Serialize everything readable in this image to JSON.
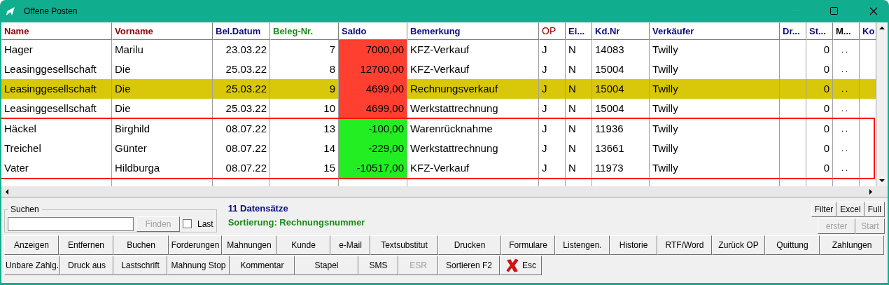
{
  "window": {
    "title": "Offene Posten"
  },
  "table": {
    "columns": [
      {
        "label": "Name",
        "color": "#8b0000"
      },
      {
        "label": "Vorname",
        "color": "#8b0000"
      },
      {
        "label": "Bel.Datum",
        "color": "#0a0a80"
      },
      {
        "label": "Beleg-Nr.",
        "color": "#1a8a1a"
      },
      {
        "label": "Saldo",
        "color": "#0a0a80"
      },
      {
        "label": "Bemerkung",
        "color": "#0a0a80"
      },
      {
        "label": "OP",
        "color": "#a00000"
      },
      {
        "label": "Ei...",
        "color": "#0a0a80"
      },
      {
        "label": "Kd.Nr",
        "color": "#0a0a80"
      },
      {
        "label": "Verkäufer",
        "color": "#0a0a80"
      },
      {
        "label": "Dr...",
        "color": "#0a0a80"
      },
      {
        "label": "St...",
        "color": "#0a0a80"
      },
      {
        "label": "M...",
        "color": "#000000"
      },
      {
        "label": "Ko",
        "color": "#0a0a80"
      }
    ],
    "rows": [
      {
        "name": "Hager",
        "vorname": "Marilu",
        "datum": "23.03.22",
        "beleg": "7",
        "saldo": {
          "text": "7000,00",
          "color": "#ff4030"
        },
        "bemerkung": "KFZ-Verkauf",
        "op": "J",
        "ei": "N",
        "kdnr": "14083",
        "verkaeufer": "Twilly",
        "st": "0",
        "m": ". .",
        "selected": false,
        "marked": false
      },
      {
        "name": "Leasinggesellschaft",
        "vorname": "Die",
        "datum": "25.03.22",
        "beleg": "8",
        "saldo": {
          "text": "12700,00",
          "color": "#ff4030"
        },
        "bemerkung": "KFZ-Verkauf",
        "op": "J",
        "ei": "N",
        "kdnr": "15004",
        "verkaeufer": "Twilly",
        "st": "0",
        "m": ". .",
        "selected": false,
        "marked": false
      },
      {
        "name": "Leasinggesellschaft",
        "vorname": "Die",
        "datum": "25.03.22",
        "beleg": "9",
        "saldo": {
          "text": "4699,00",
          "color": "#ff4030"
        },
        "bemerkung": "Rechnungsverkauf",
        "op": "J",
        "ei": "N",
        "kdnr": "15004",
        "verkaeufer": "Twilly",
        "st": "0",
        "m": ". .",
        "selected": true,
        "marked": false
      },
      {
        "name": "Leasinggesellschaft",
        "vorname": "Die",
        "datum": "25.03.22",
        "beleg": "10",
        "saldo": {
          "text": "4699,00",
          "color": "#ff4030"
        },
        "bemerkung": "Werkstattrechnung",
        "op": "J",
        "ei": "N",
        "kdnr": "15004",
        "verkaeufer": "Twilly",
        "st": "0",
        "m": ". .",
        "selected": false,
        "marked": false
      },
      {
        "name": "Häckel",
        "vorname": "Birghild",
        "datum": "08.07.22",
        "beleg": "13",
        "saldo": {
          "text": "-100,00",
          "color": "#22ee22"
        },
        "bemerkung": "Warenrücknahme",
        "op": "J",
        "ei": "N",
        "kdnr": "11936",
        "verkaeufer": "Twilly",
        "st": "0",
        "m": ". .",
        "selected": false,
        "marked": true
      },
      {
        "name": "Treichel",
        "vorname": "Günter",
        "datum": "08.07.22",
        "beleg": "14",
        "saldo": {
          "text": "-229,00",
          "color": "#22ee22"
        },
        "bemerkung": "Werkstattrechnung",
        "op": "J",
        "ei": "N",
        "kdnr": "13661",
        "verkaeufer": "Twilly",
        "st": "0",
        "m": ". .",
        "selected": false,
        "marked": true
      },
      {
        "name": "Vater",
        "vorname": "Hildburga",
        "datum": "08.07.22",
        "beleg": "15",
        "saldo": {
          "text": "-10517,00",
          "color": "#22ee22"
        },
        "bemerkung": "KFZ-Verkauf",
        "op": "J",
        "ei": "N",
        "kdnr": "11973",
        "verkaeufer": "Twilly",
        "st": "0",
        "m": ". .",
        "selected": false,
        "marked": true
      }
    ]
  },
  "search": {
    "label": "Suchen",
    "button": {
      "label": "Finden",
      "disabled": true
    },
    "last": {
      "label": "Last",
      "checked": false
    }
  },
  "info": {
    "count": "11 Datensätze",
    "sorting": "Sortierung: Rechnungsnummer"
  },
  "side_buttons": [
    {
      "label": "Filter",
      "disabled": false
    },
    {
      "label": "Excel",
      "disabled": false
    },
    {
      "label": "Full",
      "disabled": false
    },
    {
      "label": "erster",
      "disabled": true
    },
    {
      "label": "Start",
      "disabled": true
    }
  ],
  "button_rows": [
    [
      {
        "label": "Anzeigen",
        "disabled": false
      },
      {
        "label": "Entfernen",
        "disabled": false
      },
      {
        "label": "Buchen",
        "disabled": false
      },
      {
        "label": "Forderungen",
        "disabled": false
      },
      {
        "label": "Mahnungen",
        "disabled": false
      },
      {
        "label": "Kunde",
        "disabled": false
      },
      {
        "label": "e-Mail",
        "disabled": false
      },
      {
        "label": "Textsubstitut",
        "disabled": false
      },
      {
        "label": "Drucken",
        "disabled": false
      },
      {
        "label": "Formulare",
        "disabled": false
      },
      {
        "label": "Listengen.",
        "disabled": false
      },
      {
        "label": "Historie",
        "disabled": false
      },
      {
        "label": "RTF/Word",
        "disabled": false
      },
      {
        "label": "Zurück OP",
        "disabled": false
      },
      {
        "label": "Quittung",
        "disabled": false
      },
      {
        "label": "Zahlungen",
        "disabled": false
      }
    ],
    [
      {
        "label": "Unbare Zahlg.",
        "disabled": false
      },
      {
        "label": "Druck aus",
        "disabled": false
      },
      {
        "label": "Lastschrift",
        "disabled": false
      },
      {
        "label": "Mahnung Stop",
        "disabled": false
      },
      {
        "label": "Kommentar",
        "disabled": false
      },
      {
        "label": "Stapel",
        "disabled": false
      },
      {
        "label": "SMS",
        "disabled": false
      },
      {
        "label": "ESR",
        "disabled": true
      },
      {
        "label": "Sortieren F2",
        "disabled": false
      },
      {
        "label": "Esc",
        "disabled": false,
        "kind": "close"
      }
    ]
  ]
}
